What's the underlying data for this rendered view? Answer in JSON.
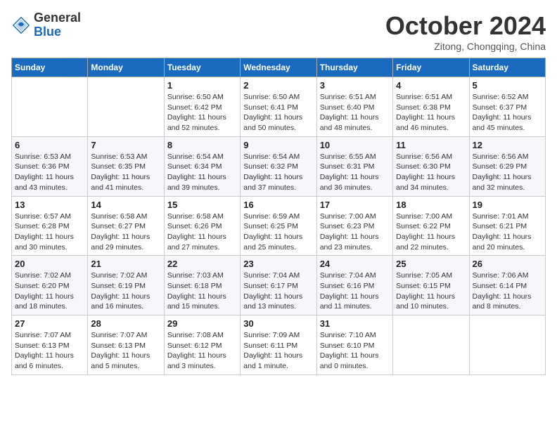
{
  "header": {
    "logo_line1": "General",
    "logo_line2": "Blue",
    "month": "October 2024",
    "location": "Zitong, Chongqing, China"
  },
  "weekdays": [
    "Sunday",
    "Monday",
    "Tuesday",
    "Wednesday",
    "Thursday",
    "Friday",
    "Saturday"
  ],
  "weeks": [
    [
      {
        "day": "",
        "detail": ""
      },
      {
        "day": "",
        "detail": ""
      },
      {
        "day": "1",
        "detail": "Sunrise: 6:50 AM\nSunset: 6:42 PM\nDaylight: 11 hours and 52 minutes."
      },
      {
        "day": "2",
        "detail": "Sunrise: 6:50 AM\nSunset: 6:41 PM\nDaylight: 11 hours and 50 minutes."
      },
      {
        "day": "3",
        "detail": "Sunrise: 6:51 AM\nSunset: 6:40 PM\nDaylight: 11 hours and 48 minutes."
      },
      {
        "day": "4",
        "detail": "Sunrise: 6:51 AM\nSunset: 6:38 PM\nDaylight: 11 hours and 46 minutes."
      },
      {
        "day": "5",
        "detail": "Sunrise: 6:52 AM\nSunset: 6:37 PM\nDaylight: 11 hours and 45 minutes."
      }
    ],
    [
      {
        "day": "6",
        "detail": "Sunrise: 6:53 AM\nSunset: 6:36 PM\nDaylight: 11 hours and 43 minutes."
      },
      {
        "day": "7",
        "detail": "Sunrise: 6:53 AM\nSunset: 6:35 PM\nDaylight: 11 hours and 41 minutes."
      },
      {
        "day": "8",
        "detail": "Sunrise: 6:54 AM\nSunset: 6:34 PM\nDaylight: 11 hours and 39 minutes."
      },
      {
        "day": "9",
        "detail": "Sunrise: 6:54 AM\nSunset: 6:32 PM\nDaylight: 11 hours and 37 minutes."
      },
      {
        "day": "10",
        "detail": "Sunrise: 6:55 AM\nSunset: 6:31 PM\nDaylight: 11 hours and 36 minutes."
      },
      {
        "day": "11",
        "detail": "Sunrise: 6:56 AM\nSunset: 6:30 PM\nDaylight: 11 hours and 34 minutes."
      },
      {
        "day": "12",
        "detail": "Sunrise: 6:56 AM\nSunset: 6:29 PM\nDaylight: 11 hours and 32 minutes."
      }
    ],
    [
      {
        "day": "13",
        "detail": "Sunrise: 6:57 AM\nSunset: 6:28 PM\nDaylight: 11 hours and 30 minutes."
      },
      {
        "day": "14",
        "detail": "Sunrise: 6:58 AM\nSunset: 6:27 PM\nDaylight: 11 hours and 29 minutes."
      },
      {
        "day": "15",
        "detail": "Sunrise: 6:58 AM\nSunset: 6:26 PM\nDaylight: 11 hours and 27 minutes."
      },
      {
        "day": "16",
        "detail": "Sunrise: 6:59 AM\nSunset: 6:25 PM\nDaylight: 11 hours and 25 minutes."
      },
      {
        "day": "17",
        "detail": "Sunrise: 7:00 AM\nSunset: 6:23 PM\nDaylight: 11 hours and 23 minutes."
      },
      {
        "day": "18",
        "detail": "Sunrise: 7:00 AM\nSunset: 6:22 PM\nDaylight: 11 hours and 22 minutes."
      },
      {
        "day": "19",
        "detail": "Sunrise: 7:01 AM\nSunset: 6:21 PM\nDaylight: 11 hours and 20 minutes."
      }
    ],
    [
      {
        "day": "20",
        "detail": "Sunrise: 7:02 AM\nSunset: 6:20 PM\nDaylight: 11 hours and 18 minutes."
      },
      {
        "day": "21",
        "detail": "Sunrise: 7:02 AM\nSunset: 6:19 PM\nDaylight: 11 hours and 16 minutes."
      },
      {
        "day": "22",
        "detail": "Sunrise: 7:03 AM\nSunset: 6:18 PM\nDaylight: 11 hours and 15 minutes."
      },
      {
        "day": "23",
        "detail": "Sunrise: 7:04 AM\nSunset: 6:17 PM\nDaylight: 11 hours and 13 minutes."
      },
      {
        "day": "24",
        "detail": "Sunrise: 7:04 AM\nSunset: 6:16 PM\nDaylight: 11 hours and 11 minutes."
      },
      {
        "day": "25",
        "detail": "Sunrise: 7:05 AM\nSunset: 6:15 PM\nDaylight: 11 hours and 10 minutes."
      },
      {
        "day": "26",
        "detail": "Sunrise: 7:06 AM\nSunset: 6:14 PM\nDaylight: 11 hours and 8 minutes."
      }
    ],
    [
      {
        "day": "27",
        "detail": "Sunrise: 7:07 AM\nSunset: 6:13 PM\nDaylight: 11 hours and 6 minutes."
      },
      {
        "day": "28",
        "detail": "Sunrise: 7:07 AM\nSunset: 6:13 PM\nDaylight: 11 hours and 5 minutes."
      },
      {
        "day": "29",
        "detail": "Sunrise: 7:08 AM\nSunset: 6:12 PM\nDaylight: 11 hours and 3 minutes."
      },
      {
        "day": "30",
        "detail": "Sunrise: 7:09 AM\nSunset: 6:11 PM\nDaylight: 11 hours and 1 minute."
      },
      {
        "day": "31",
        "detail": "Sunrise: 7:10 AM\nSunset: 6:10 PM\nDaylight: 11 hours and 0 minutes."
      },
      {
        "day": "",
        "detail": ""
      },
      {
        "day": "",
        "detail": ""
      }
    ]
  ]
}
